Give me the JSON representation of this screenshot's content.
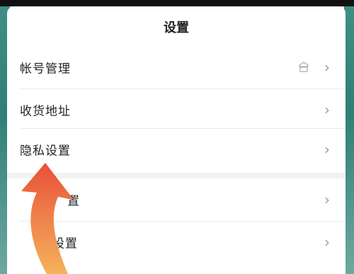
{
  "header": {
    "title": "设置"
  },
  "items": [
    {
      "label": "帐号管理",
      "chevron": "›",
      "icon": "shield-icon"
    },
    {
      "label": "收货地址",
      "chevron": "›"
    },
    {
      "label": "隐私设置",
      "chevron": "›"
    },
    {
      "label": "置",
      "chevron": "›"
    },
    {
      "label": "设置",
      "chevron": "›"
    }
  ],
  "colors": {
    "arrow_top": "#e8503a",
    "arrow_bottom": "#f5b35a",
    "accent_teal": "#2e7f78"
  }
}
